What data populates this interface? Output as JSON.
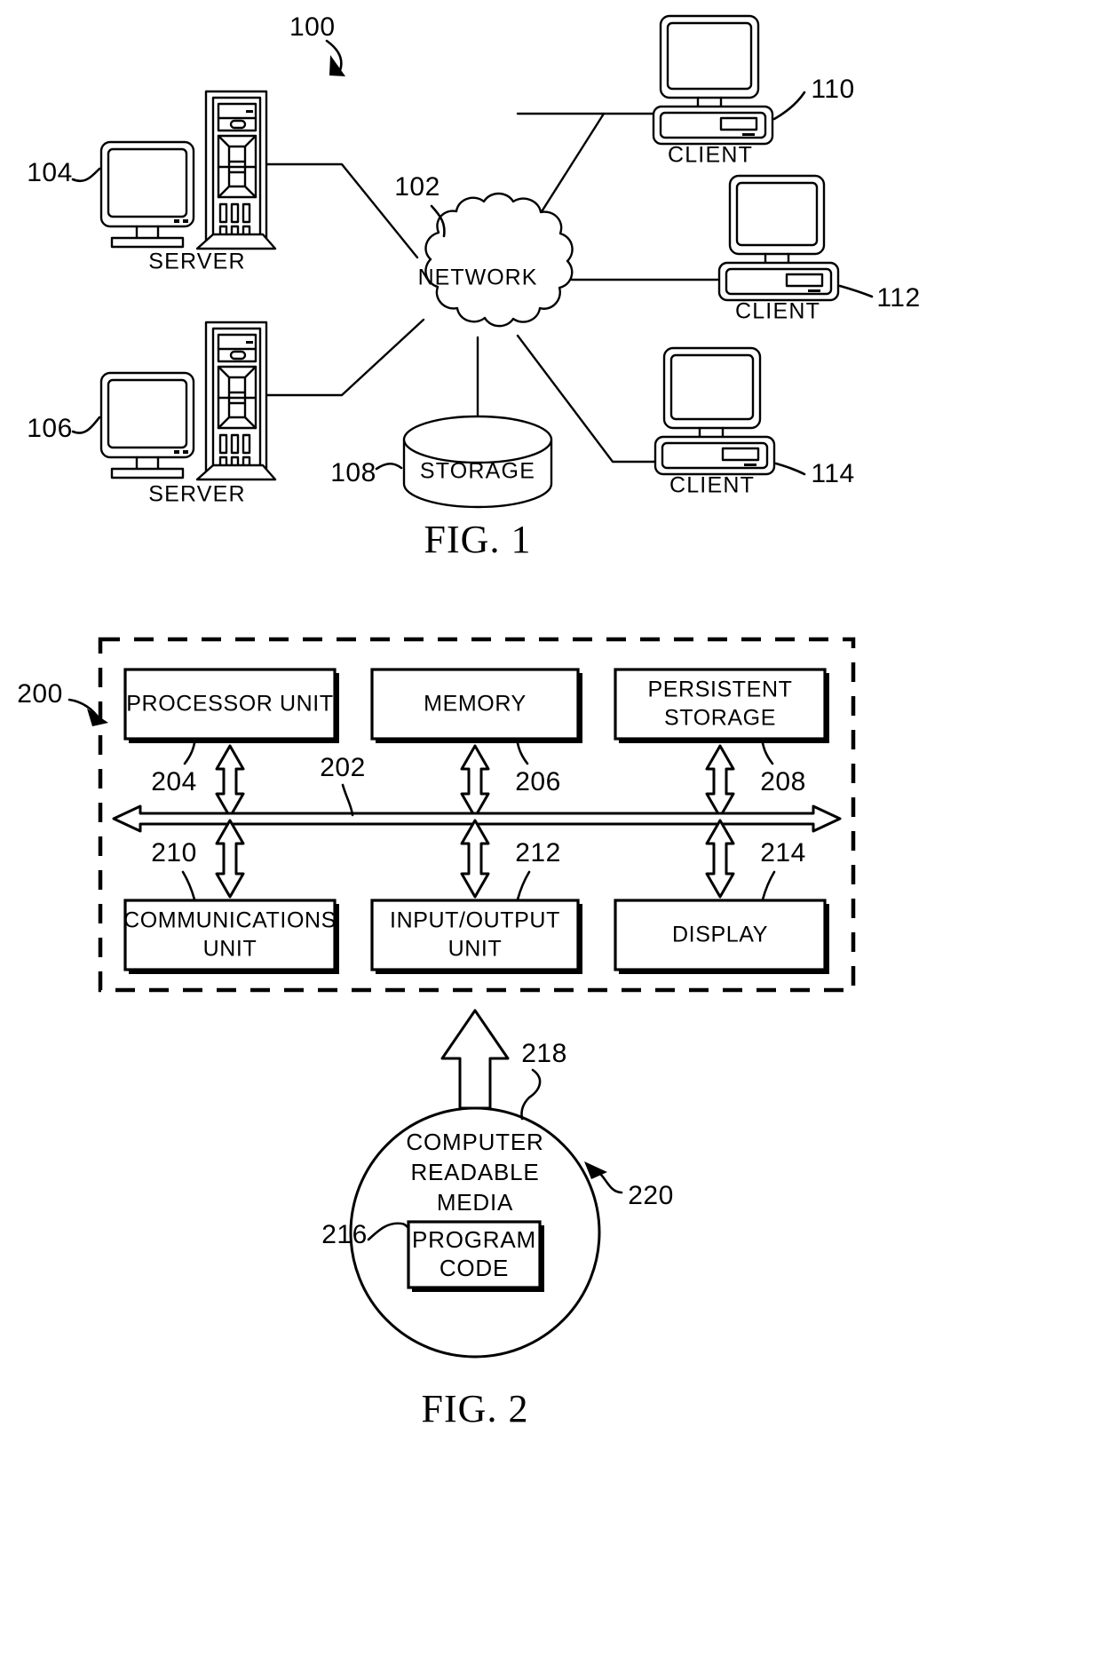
{
  "document": {
    "type": "patent-figure-sheet",
    "figures": [
      "FIG. 1",
      "FIG. 2"
    ]
  },
  "figure1": {
    "caption": "FIG. 1",
    "system_ref": "100",
    "nodes": {
      "network": {
        "label": "NETWORK",
        "ref": "102",
        "icon": "cloud-icon"
      },
      "storage": {
        "label": "STORAGE",
        "ref": "108",
        "icon": "cylinder-icon"
      },
      "server_top": {
        "label": "SERVER",
        "ref": "104",
        "icon": "server-tower-icon"
      },
      "server_bottom": {
        "label": "SERVER",
        "ref": "106",
        "icon": "server-tower-icon"
      },
      "client_top": {
        "label": "CLIENT",
        "ref": "110",
        "icon": "desktop-computer-icon"
      },
      "client_middle": {
        "label": "CLIENT",
        "ref": "112",
        "icon": "desktop-computer-icon"
      },
      "client_bottom": {
        "label": "CLIENT",
        "ref": "114",
        "icon": "desktop-computer-icon"
      }
    }
  },
  "figure2": {
    "caption": "FIG. 2",
    "system_ref": "200",
    "bus": {
      "ref": "202",
      "name": "system-bus"
    },
    "blocks": [
      {
        "label": "PROCESSOR UNIT",
        "ref": "204"
      },
      {
        "label": "MEMORY",
        "ref": "206"
      },
      {
        "label": "PERSISTENT STORAGE",
        "ref": "208"
      },
      {
        "label": "COMMUNICATIONS UNIT",
        "ref": "210"
      },
      {
        "label": "INPUT/OUTPUT UNIT",
        "ref": "212"
      },
      {
        "label": "DISPLAY",
        "ref": "214"
      }
    ],
    "media": {
      "label": "COMPUTER READABLE MEDIA",
      "label_lines": [
        "COMPUTER",
        "READABLE",
        "MEDIA"
      ],
      "ref": "218",
      "program_code": {
        "label": "PROGRAM CODE",
        "label_lines": [
          "PROGRAM",
          "CODE"
        ],
        "ref": "216"
      },
      "product_ref": "220"
    }
  }
}
